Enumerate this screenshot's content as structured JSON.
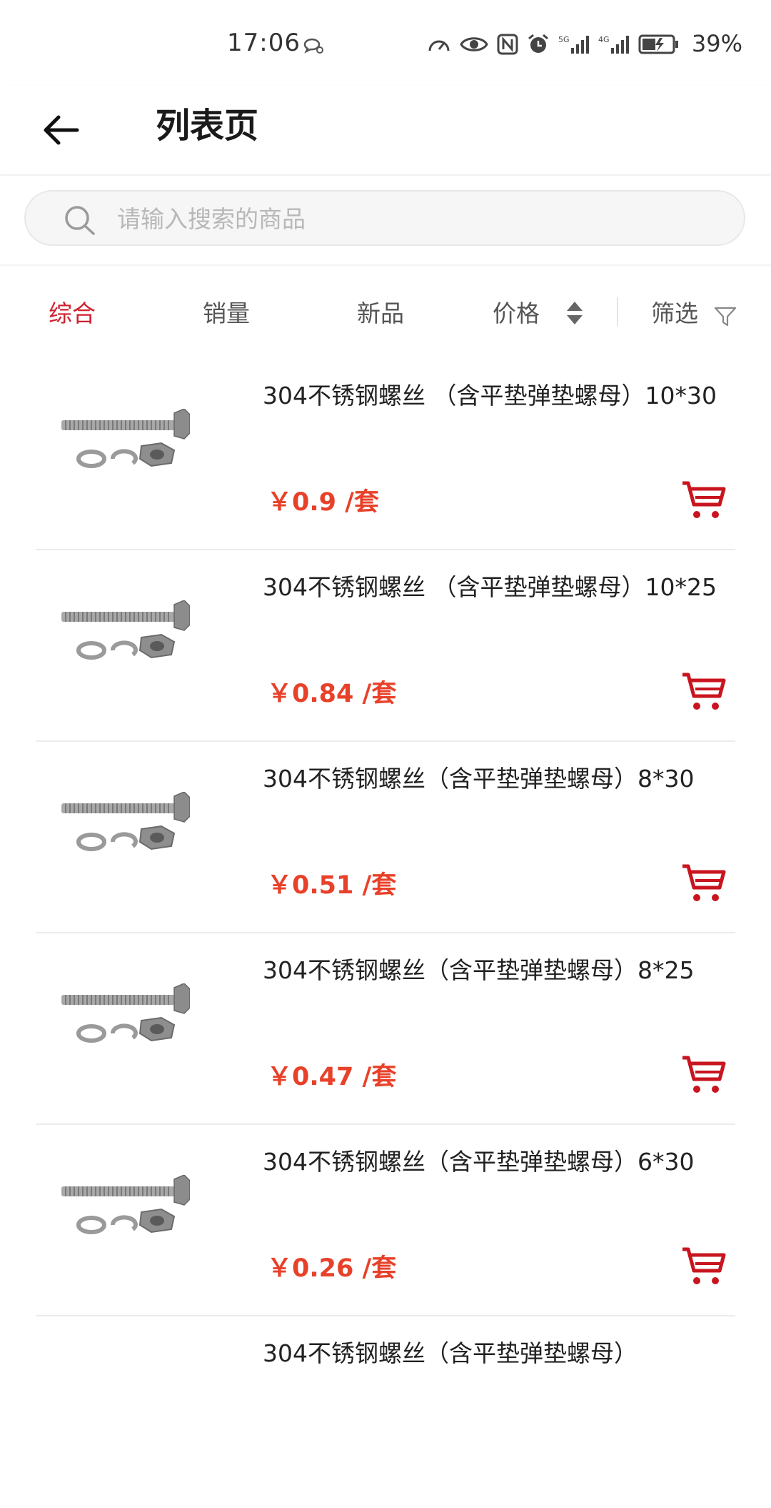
{
  "status_bar": {
    "time": "17:06",
    "battery": "39%"
  },
  "header": {
    "title": "列表页"
  },
  "search": {
    "placeholder": "请输入搜索的商品"
  },
  "sort": {
    "items": [
      {
        "label": "综合",
        "active": true
      },
      {
        "label": "销量",
        "active": false
      },
      {
        "label": "新品",
        "active": false
      },
      {
        "label": "价格",
        "active": false
      },
      {
        "label": "筛选",
        "active": false
      }
    ]
  },
  "products": [
    {
      "name": "304不锈钢螺丝 （含平垫弹垫螺母）10*30",
      "price": "￥0.9 /套"
    },
    {
      "name": "304不锈钢螺丝 （含平垫弹垫螺母）10*25",
      "price": "￥0.84 /套"
    },
    {
      "name": "304不锈钢螺丝（含平垫弹垫螺母）8*30",
      "price": "￥0.51 /套"
    },
    {
      "name": "304不锈钢螺丝（含平垫弹垫螺母）8*25",
      "price": "￥0.47 /套"
    },
    {
      "name": "304不锈钢螺丝（含平垫弹垫螺母）6*30",
      "price": "￥0.26 /套"
    },
    {
      "name": "304不锈钢螺丝（含平垫弹垫螺母）",
      "price": ""
    }
  ],
  "colors": {
    "accent": "#d0202e",
    "price": "#e8412a",
    "cart": "#c8151f"
  }
}
